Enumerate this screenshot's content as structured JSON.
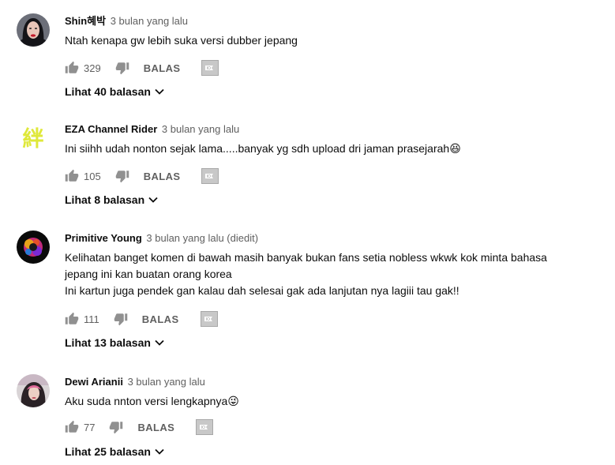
{
  "comments": [
    {
      "author": "Shin혜박",
      "time": "3 bulan yang lalu",
      "text_lines": [
        "Ntah kenapa gw lebih suka versi dubber jepang"
      ],
      "likes": "329",
      "reply_label": "BALAS",
      "replies_label": "Lihat 40 balasan",
      "avatar_icon": "avatar-woman-red-lips"
    },
    {
      "author": "EZA Channel Rider",
      "time": "3 bulan yang lalu",
      "text_lines": [
        "Ini siihh udah nonton sejak lama.....banyak yg sdh upload dri jaman prasejarah😆"
      ],
      "likes": "105",
      "reply_label": "BALAS",
      "replies_label": "Lihat 8 balasan",
      "avatar_icon": "avatar-kanji-logo"
    },
    {
      "author": "Primitive Young",
      "time": "3 bulan yang lalu (diedit)",
      "text_lines": [
        "Kelihatan banget komen di bawah masih banyak bukan fans setia nobless wkwk kok minta bahasa",
        "jepang ini kan buatan orang korea",
        "Ini kartun juga pendek gan kalau dah selesai gak ada lanjutan nya lagiii tau gak!!"
      ],
      "likes": "111",
      "reply_label": "BALAS",
      "replies_label": "Lihat 13 balasan",
      "avatar_icon": "avatar-colorful-logo"
    },
    {
      "author": "Dewi Arianii",
      "time": "3 bulan yang lalu",
      "text_lines": [
        "Aku suda nnton versi lengkapnya😜"
      ],
      "likes": "77",
      "reply_label": "BALAS",
      "replies_label": "Lihat 25 balasan",
      "avatar_icon": "avatar-woman-photo"
    }
  ],
  "colors": {
    "icon_gray": "#909090",
    "meta_gray": "#606060",
    "text": "#0d0d0d"
  }
}
